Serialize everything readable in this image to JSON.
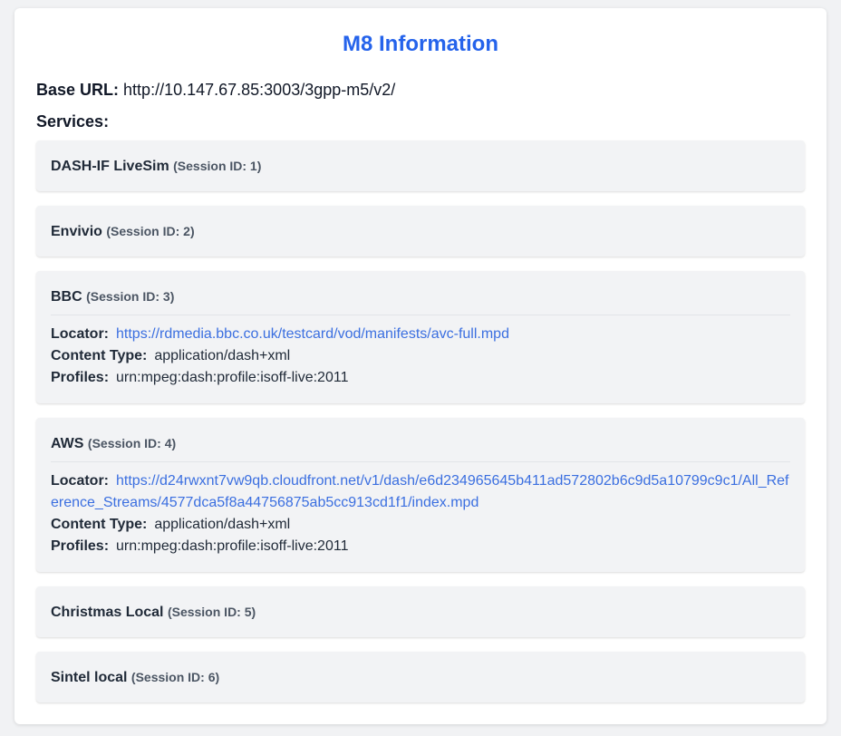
{
  "page": {
    "title": "M8 Information",
    "base_url_label": "Base URL:",
    "base_url_value": "http://10.147.67.85:3003/3gpp-m5/v2/",
    "services_heading": "Services:"
  },
  "labels": {
    "locator": "Locator:",
    "content_type": "Content Type:",
    "profiles": "Profiles:"
  },
  "services": [
    {
      "name": "DASH-IF LiveSim",
      "session": "(Session ID: 1)"
    },
    {
      "name": "Envivio",
      "session": "(Session ID: 2)"
    },
    {
      "name": "BBC",
      "session": "(Session ID: 3)",
      "locator": "https://rdmedia.bbc.co.uk/testcard/vod/manifests/avc-full.mpd",
      "content_type": "application/dash+xml",
      "profiles": "urn:mpeg:dash:profile:isoff-live:2011"
    },
    {
      "name": "AWS",
      "session": "(Session ID: 4)",
      "locator": "https://d24rwxnt7vw9qb.cloudfront.net/v1/dash/e6d234965645b411ad572802b6c9d5a10799c9c1/All_Reference_Streams/4577dca5f8a44756875ab5cc913cd1f1/index.mpd",
      "content_type": "application/dash+xml",
      "profiles": "urn:mpeg:dash:profile:isoff-live:2011"
    },
    {
      "name": "Christmas Local",
      "session": "(Session ID: 5)"
    },
    {
      "name": "Sintel local",
      "session": "(Session ID: 6)"
    }
  ],
  "colors": {
    "title": "#2563eb",
    "link": "#3b6fe0",
    "card_background": "#f2f3f5",
    "page_background": "#f1f2f4"
  }
}
